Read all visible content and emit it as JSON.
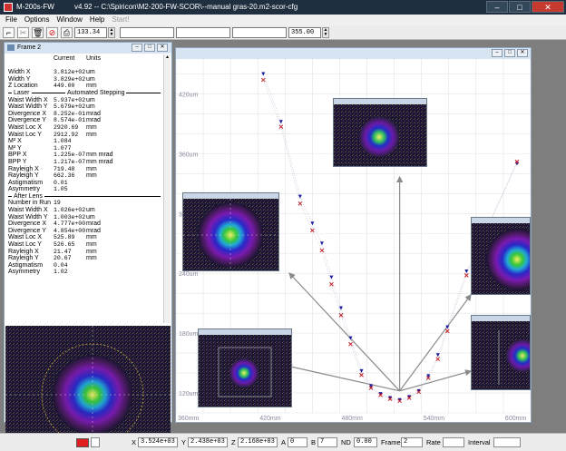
{
  "app": {
    "title": "M-200s-FW",
    "path": "v4.92 -- C:\\Spiricon\\M2-200-FW-SCOR\\--manual gras-20.m2-scor-cfg",
    "win_min": "–",
    "win_max": "□",
    "win_close": "✕"
  },
  "menu": {
    "file": "File",
    "options": "Options",
    "window": "Window",
    "help": "Help",
    "start": "Start!"
  },
  "toolbar": {
    "value1": "133.34",
    "value2": "355.00"
  },
  "frame2": {
    "title": "Frame 2",
    "col_current": "Current",
    "col_units": "Units",
    "top_rows": [
      {
        "label": "Width X",
        "value": "3.812e+02",
        "unit": "um"
      },
      {
        "label": "Width Y",
        "value": "3.829e+02",
        "unit": "um"
      },
      {
        "label": "Z Location",
        "value": "449.00",
        "unit": "mm"
      }
    ],
    "section_laser": "Laser",
    "section_auto": "Automated Stepping",
    "laser_rows": [
      {
        "label": "Waist Width X",
        "value": "5.937e+02",
        "unit": "um"
      },
      {
        "label": "Waist Width Y",
        "value": "5.679e+02",
        "unit": "um"
      },
      {
        "label": "Divergence X",
        "value": "8.252e-01",
        "unit": "mrad"
      },
      {
        "label": "Divergence Y",
        "value": "8.574e-01",
        "unit": "mrad"
      },
      {
        "label": "Waist Loc X",
        "value": "2920.69",
        "unit": "mm"
      },
      {
        "label": "Waist Loc Y",
        "value": "2912.92",
        "unit": "mm"
      },
      {
        "label": "M² X",
        "value": "1.084",
        "unit": ""
      },
      {
        "label": "M² Y",
        "value": "1.077",
        "unit": ""
      },
      {
        "label": "BPP X",
        "value": "1.225e-07",
        "unit": "mm mrad"
      },
      {
        "label": "BPP Y",
        "value": "1.217e-07",
        "unit": "mm mrad"
      },
      {
        "label": "Rayleigh X",
        "value": "719.48",
        "unit": "mm"
      },
      {
        "label": "Rayleigh Y",
        "value": "662.36",
        "unit": "mm"
      },
      {
        "label": "Astigmatism",
        "value": "0.01",
        "unit": ""
      },
      {
        "label": "Asymmetry",
        "value": "1.05",
        "unit": ""
      }
    ],
    "section_after": "After Lens",
    "after_rows": [
      {
        "label": "Number in Run",
        "value": "19",
        "unit": ""
      },
      {
        "label": "Waist Width X",
        "value": "1.026e+02",
        "unit": "um"
      },
      {
        "label": "Waist Width Y",
        "value": "1.003e+02",
        "unit": "um"
      },
      {
        "label": "Divergence X",
        "value": "4.777e+00",
        "unit": "mrad"
      },
      {
        "label": "Divergence Y",
        "value": "4.854e+00",
        "unit": "mrad"
      },
      {
        "label": "Waist Loc X",
        "value": "525.89",
        "unit": "mm"
      },
      {
        "label": "Waist Loc Y",
        "value": "526.65",
        "unit": "mm"
      },
      {
        "label": "Rayleigh X",
        "value": "21.47",
        "unit": "mm"
      },
      {
        "label": "Rayleigh Y",
        "value": "20.67",
        "unit": "mm"
      },
      {
        "label": "Astigmatism",
        "value": "0.04",
        "unit": ""
      },
      {
        "label": "Asymmetry",
        "value": "1.02",
        "unit": ""
      }
    ]
  },
  "chart_data": {
    "type": "scatter",
    "xlabel": "",
    "ylabel": "",
    "x_ticks": [
      "360mm",
      "420mm",
      "480mm",
      "540mm",
      "600mm"
    ],
    "y_ticks": [
      "120um",
      "180um",
      "240um",
      "300um",
      "360um",
      "420um"
    ],
    "xlim": [
      360,
      620
    ],
    "ylim": [
      100,
      455
    ],
    "series": [
      {
        "color": "#1a1aa0",
        "points": [
          [
            424,
            440
          ],
          [
            437,
            392
          ],
          [
            451,
            317
          ],
          [
            460,
            290
          ],
          [
            467,
            270
          ],
          [
            474,
            236
          ],
          [
            481,
            205
          ],
          [
            488,
            175
          ],
          [
            496,
            142
          ],
          [
            503,
            127
          ],
          [
            510,
            119
          ],
          [
            517,
            115
          ],
          [
            524,
            113
          ],
          [
            531,
            116
          ],
          [
            538,
            122
          ],
          [
            545,
            137
          ],
          [
            552,
            158
          ],
          [
            559,
            186
          ],
          [
            573,
            242
          ],
          [
            610,
            350
          ]
        ]
      },
      {
        "color": "#c0202a",
        "points": [
          [
            424,
            434
          ],
          [
            437,
            387
          ],
          [
            451,
            310
          ],
          [
            460,
            283
          ],
          [
            467,
            263
          ],
          [
            474,
            229
          ],
          [
            481,
            198
          ],
          [
            488,
            169
          ],
          [
            496,
            138
          ],
          [
            503,
            125
          ],
          [
            510,
            118
          ],
          [
            517,
            114
          ],
          [
            524,
            112
          ],
          [
            531,
            115
          ],
          [
            538,
            121
          ],
          [
            545,
            135
          ],
          [
            552,
            154
          ],
          [
            559,
            182
          ],
          [
            573,
            238
          ],
          [
            610,
            352
          ]
        ]
      }
    ]
  },
  "status": {
    "x_label": "X",
    "x_value": "3.524e+03",
    "y_label": "Y",
    "y_value": "2.438e+03",
    "z_label": "Z",
    "z_value": "2.168e+03",
    "a_label": "A",
    "a_value": "0",
    "b_label": "B",
    "b_value": "7",
    "nd_label": "ND",
    "nd_value": "0.00",
    "frame_label": "Frame",
    "frame_value": "2",
    "rate_label": "Rate",
    "rate_value": "",
    "interval_label": "Interval",
    "interval_value": ""
  }
}
